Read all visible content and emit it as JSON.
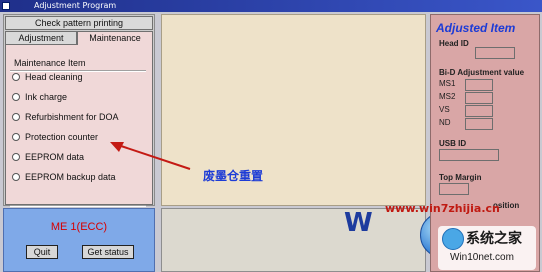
{
  "window": {
    "title": "Adjustment Program"
  },
  "left_panel": {
    "tab_row1": "Check pattern printing",
    "tabs": [
      {
        "label": "Adjustment"
      },
      {
        "label": "Maintenance"
      }
    ],
    "group_title": "Maintenance Item",
    "items": [
      {
        "label": "Head cleaning"
      },
      {
        "label": "Ink charge"
      },
      {
        "label": "Refurbishment for DOA"
      },
      {
        "label": "Protection counter"
      },
      {
        "label": "EEPROM data"
      },
      {
        "label": "EEPROM backup data"
      }
    ]
  },
  "bottom_left": {
    "model_label": "ME 1(ECC)",
    "quit_label": "Quit",
    "status_label": "Get status"
  },
  "annotation": {
    "text": "废墨仓重置"
  },
  "right_panel": {
    "title": "Adjusted Item",
    "head_id_label": "Head ID",
    "bid_label": "Bi-D Adjustment value",
    "bid_rows": [
      "MS1",
      "MS2",
      "VS",
      "ND"
    ],
    "usb_label": "USB ID",
    "top_margin_label": "Top Margin",
    "position_label": "osition"
  },
  "watermark": {
    "url": "www.win7zhijia.cn",
    "brand_partial": "W",
    "logo_title": "系统之家",
    "logo_sub": "Win10net.com"
  },
  "colors": {
    "left_panel_bg": "#f0d8d8",
    "center_panel_bg": "#eee2c9",
    "right_panel_bg": "#d9a6a6",
    "bottom_left_bg": "#7fa9e8",
    "accent_blue": "#1c3bd6",
    "alert_red": "#d60000"
  }
}
